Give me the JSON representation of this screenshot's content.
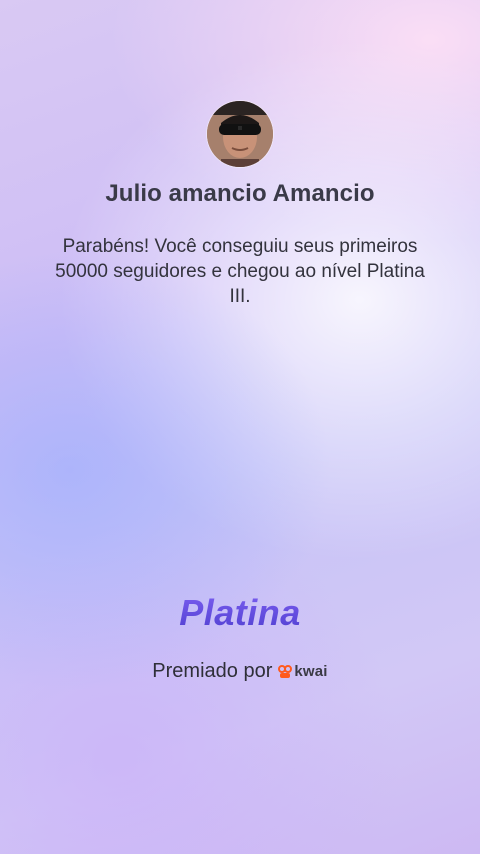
{
  "profile": {
    "name": "Julio amancio Amancio",
    "avatar_icon": "user-avatar-photo"
  },
  "message": {
    "text": "Parabéns! Você conseguiu seus primeiros 50000 seguidores e chegou ao nível Platina III."
  },
  "tier": {
    "label": "Platina",
    "color": "#5b45da"
  },
  "awarded": {
    "label": "Premiado por",
    "brand_text": "kwai",
    "brand_icon": "kwai-logo-icon",
    "brand_color": "#ff5a1f"
  }
}
